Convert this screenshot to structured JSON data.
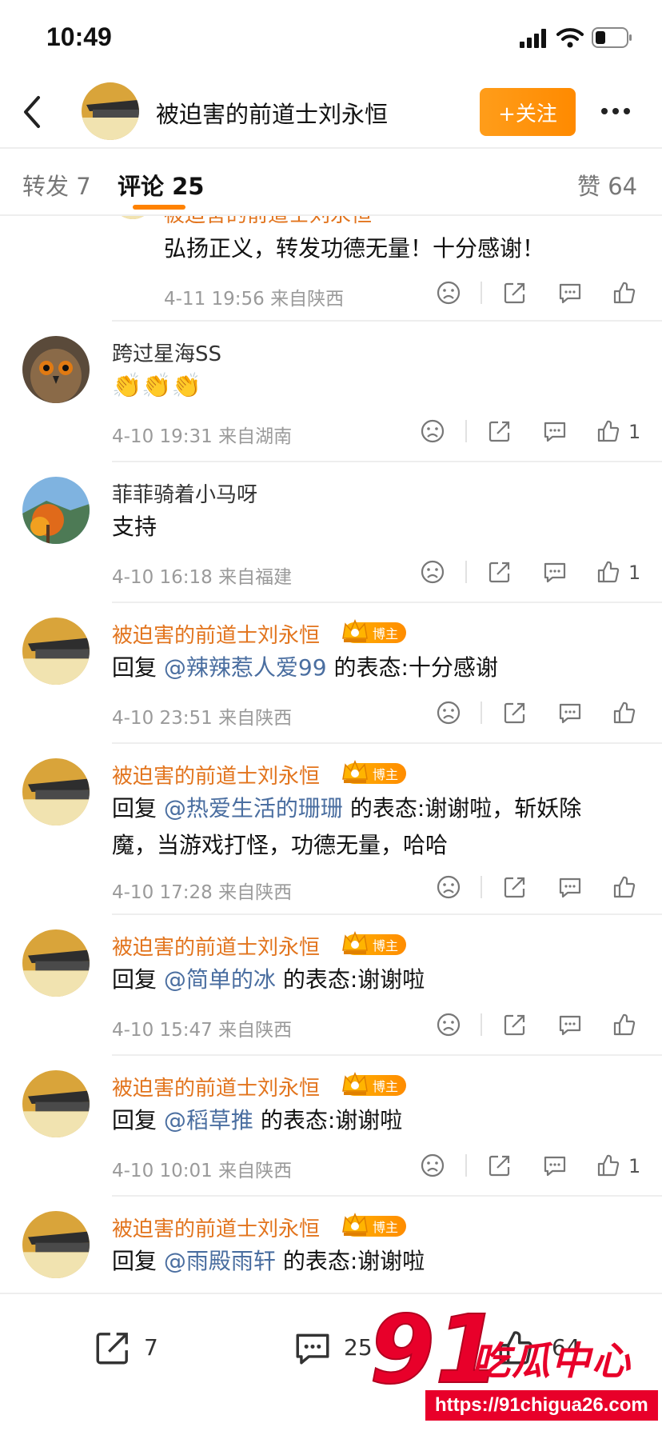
{
  "status": {
    "time": "10:49"
  },
  "header": {
    "title": "被迫害的前道士刘永恒",
    "follow_label": "+关注"
  },
  "tabs": {
    "repost": "转发 7",
    "comment": "评论 25",
    "like": "赞 64"
  },
  "partial_comment": {
    "name_cut": "被迫害的前道士刘永恒",
    "text": "弘扬正义，转发功德无量！十分感谢！",
    "meta": "4-11 19:56  来自陕西"
  },
  "comments": [
    {
      "name": "跨过星海SS",
      "text": "👏👏👏",
      "meta": "4-10 19:31  来自湖南",
      "likes": "1"
    },
    {
      "name": "菲菲骑着小马呀",
      "text": "支持",
      "meta": "4-10 16:18  来自福建",
      "likes": "1"
    },
    {
      "name": "被迫害的前道士刘永恒",
      "badge": "博主",
      "reply_prefix": "回复 ",
      "mention": "@辣辣惹人爱99",
      "text_after": " 的表态:十分感谢",
      "meta": "4-10 23:51  来自陕西",
      "likes": ""
    },
    {
      "name": "被迫害的前道士刘永恒",
      "badge": "博主",
      "reply_prefix": "回复 ",
      "mention": "@热爱生活的珊珊",
      "text_after": " 的表态:谢谢啦，斩妖除",
      "text_line2": "魔，当游戏打怪，功德无量，哈哈",
      "meta": "4-10 17:28  来自陕西",
      "likes": ""
    },
    {
      "name": "被迫害的前道士刘永恒",
      "badge": "博主",
      "reply_prefix": "回复 ",
      "mention": "@简单的冰",
      "text_after": " 的表态:谢谢啦",
      "meta": "4-10 15:47  来自陕西",
      "likes": ""
    },
    {
      "name": "被迫害的前道士刘永恒",
      "badge": "博主",
      "reply_prefix": "回复 ",
      "mention": "@稻草推",
      "text_after": " 的表态:谢谢啦",
      "meta": "4-10 10:01  来自陕西",
      "likes": "1"
    },
    {
      "name": "被迫害的前道士刘永恒",
      "badge": "博主",
      "reply_prefix": "回复 ",
      "mention": "@雨殿雨轩",
      "text_after": " 的表态:谢谢啦"
    }
  ],
  "bottom_bar": {
    "repost_count": "7",
    "comment_count": "25",
    "like_count": "64"
  },
  "watermark": {
    "number": "91",
    "brand": "吃瓜中心",
    "url": "https://91chigua26.com"
  },
  "colors": {
    "accent_orange": "#ff8200",
    "blogger_name": "#e2741d",
    "mention_blue": "#4a6ea0",
    "watermark_red": "#e8002a"
  },
  "icons": [
    "signal-icon",
    "wifi-icon",
    "battery-icon",
    "back-icon",
    "more-icon",
    "dislike-icon",
    "repost-icon",
    "comment-icon",
    "like-icon",
    "crown-icon"
  ]
}
